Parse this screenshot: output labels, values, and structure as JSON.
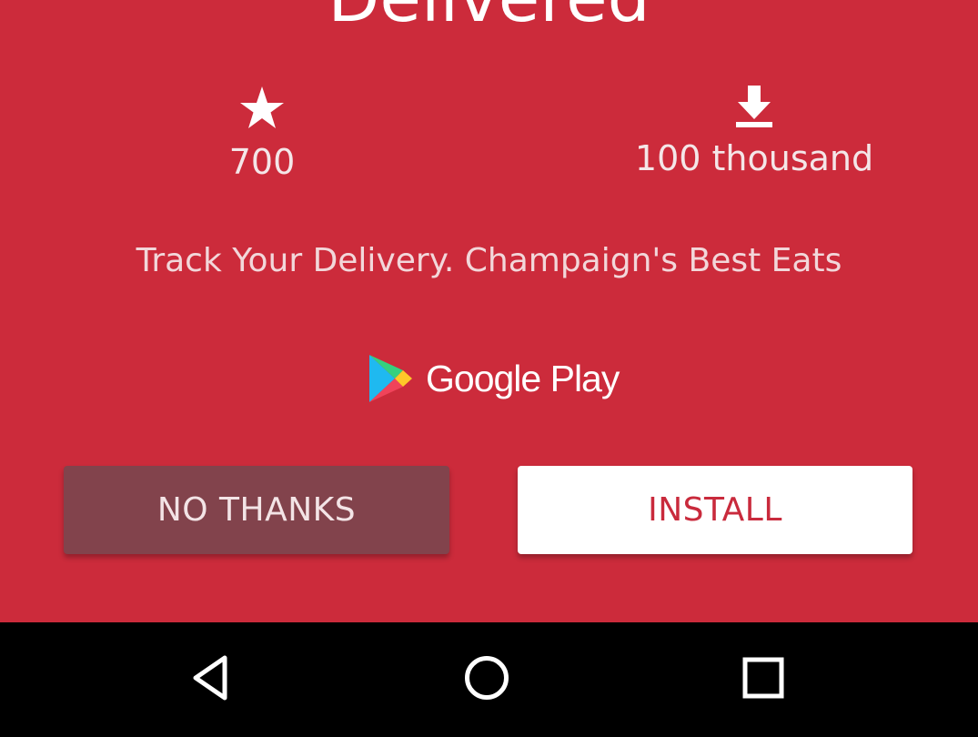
{
  "promo": {
    "app_title": "Delivered",
    "background_color": "#cc2b3b",
    "rating": {
      "icon": "star-icon",
      "value": "700"
    },
    "downloads": {
      "icon": "download-icon",
      "value": "100 thousand"
    },
    "tagline": "Track Your Delivery. Champaign's Best Eats",
    "store_badge": {
      "icon": "google-play-icon",
      "label": "Google Play"
    },
    "buttons": {
      "no_thanks": "NO THANKS",
      "install": "INSTALL"
    }
  },
  "navbar": {
    "items": [
      {
        "name": "back",
        "icon": "back-triangle-icon"
      },
      {
        "name": "home",
        "icon": "home-circle-icon"
      },
      {
        "name": "recents",
        "icon": "recents-square-icon"
      }
    ]
  }
}
